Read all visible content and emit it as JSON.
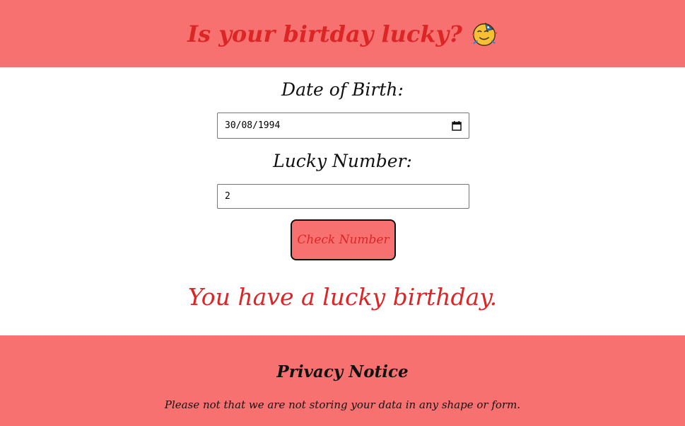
{
  "header": {
    "title": "Is your birtday lucky?",
    "icon": "party-face-icon",
    "bg_color": "#f87171",
    "title_color": "#dc2626"
  },
  "form": {
    "dob_label": "Date of Birth:",
    "dob_value": "30/08/1994",
    "lucky_label": "Lucky Number:",
    "lucky_value": "2",
    "check_button_label": "Check Number"
  },
  "result": {
    "message": "You have a lucky birthday.",
    "color": "#dc2626"
  },
  "footer": {
    "title": "Privacy Notice",
    "text": "Please not that we are not storing your data in any shape or form."
  }
}
